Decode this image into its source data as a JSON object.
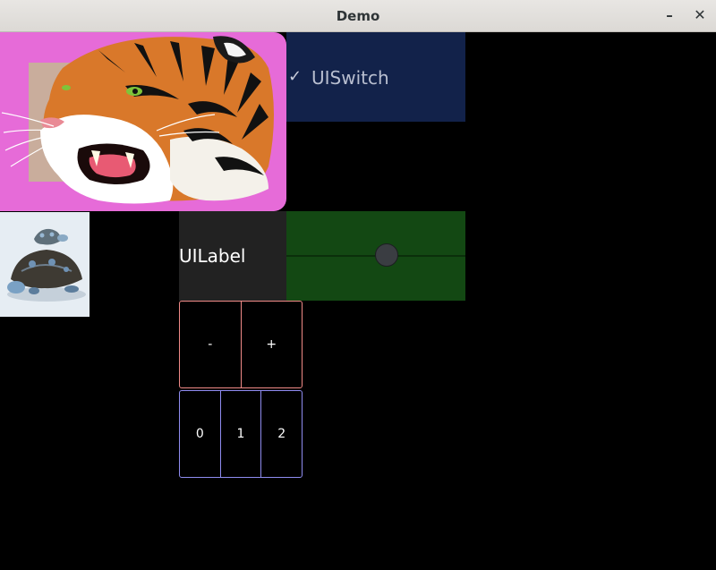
{
  "window": {
    "title": "Demo",
    "minimize_label": "–",
    "close_label": "✕"
  },
  "images": {
    "tiger": "tiger-image",
    "turtle": "turtle-image"
  },
  "switch": {
    "label": "UISwitch",
    "check_glyph": "✓",
    "checked": true
  },
  "label": {
    "text": "UILabel"
  },
  "slider": {
    "value": 0.5
  },
  "stepper": {
    "minus": "-",
    "plus": "+"
  },
  "segmented": {
    "segments": [
      "0",
      "1",
      "2"
    ]
  },
  "colors": {
    "tiger_bg": "#e66bd8",
    "switch_bg": "#12224a",
    "label_bg": "#222222",
    "slider_bg": "#134813",
    "stepper_border": "#f08a87",
    "segmented_border": "#8f8cf0"
  }
}
